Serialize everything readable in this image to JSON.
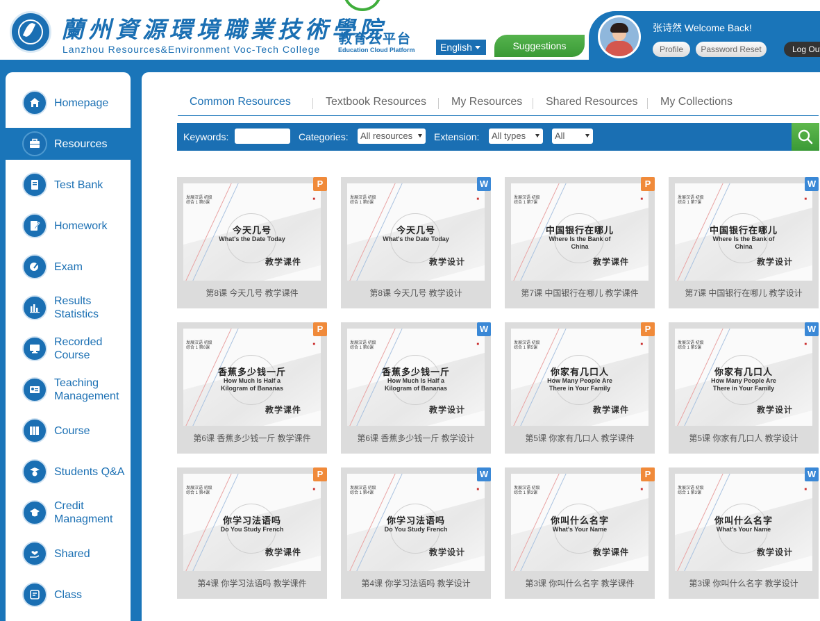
{
  "header": {
    "college_cn": "蘭州資源環境職業技術學院",
    "college_en": "Lanzhou Resources&Environment Voc-Tech College",
    "platform_cn": "教育云平台",
    "platform_en": "Education Cloud Platform",
    "language_label": "English",
    "suggestions_label": "Suggestions",
    "welcome_text": "张诗然 Welcome Back!",
    "profile_label": "Profile",
    "password_reset_label": "Password Reset",
    "logout_label": "Log Out"
  },
  "sidebar": {
    "items": [
      {
        "label": "Homepage",
        "icon": "home-icon"
      },
      {
        "label": "Resources",
        "icon": "briefcase-icon",
        "active": true
      },
      {
        "label": "Test Bank",
        "icon": "notebook-icon"
      },
      {
        "label": "Homework",
        "icon": "pencil-book-icon"
      },
      {
        "label": "Exam",
        "icon": "exam-pen-icon"
      },
      {
        "label": "Results Statistics",
        "icon": "bar-chart-icon"
      },
      {
        "label": "Recorded Course",
        "icon": "monitor-icon"
      },
      {
        "label": "Teaching Management",
        "icon": "id-card-icon"
      },
      {
        "label": "Course",
        "icon": "books-icon"
      },
      {
        "label": "Students Q&A",
        "icon": "student-question-icon"
      },
      {
        "label": "Credit Managment",
        "icon": "graduation-cap-icon"
      },
      {
        "label": "Shared",
        "icon": "hand-heart-icon"
      },
      {
        "label": "Class",
        "icon": "class-book-icon"
      }
    ]
  },
  "tabs": [
    {
      "label": "Common Resources",
      "active": true
    },
    {
      "label": "Textbook Resources"
    },
    {
      "label": "My Resources"
    },
    {
      "label": "Shared Resources"
    },
    {
      "label": "My Collections"
    }
  ],
  "filters": {
    "keywords_label": "Keywords:",
    "keywords_value": "",
    "categories_label": "Categories:",
    "categories_value": "All resources",
    "extension_label": "Extension:",
    "extension_value": "All types",
    "extra_value": "All"
  },
  "colors": {
    "brand_blue": "#1a75b9",
    "accent_green": "#3fae3b",
    "ppt_orange": "#f08a3a",
    "word_blue": "#3a88d6"
  },
  "resources": [
    {
      "badge": "P",
      "note": "发展汉语 初级综合 1 第8课",
      "title_cn": "今天几号",
      "title_en": "What's the Date Today",
      "kind": "教学课件",
      "caption": "第8课 今天几号 教学课件"
    },
    {
      "badge": "W",
      "note": "发展汉语 初级综合 1 第8课",
      "title_cn": "今天几号",
      "title_en": "What's the Date Today",
      "kind": "教学设计",
      "caption": "第8课 今天几号 教学设计"
    },
    {
      "badge": "P",
      "note": "发展汉语 初级综合 1 第7课",
      "title_cn": "中国银行在哪儿",
      "title_en": "Where Is the Bank of China",
      "kind": "教学课件",
      "caption": "第7课 中国银行在哪儿 教学课件"
    },
    {
      "badge": "W",
      "note": "发展汉语 初级综合 1 第7课",
      "title_cn": "中国银行在哪儿",
      "title_en": "Where Is the Bank of China",
      "kind": "教学设计",
      "caption": "第7课 中国银行在哪儿 教学设计"
    },
    {
      "badge": "P",
      "note": "发展汉语 初级综合 1 第6课",
      "title_cn": "香蕉多少钱一斤",
      "title_en": "How Much Is Half a Kilogram of Bananas",
      "kind": "教学课件",
      "caption": "第6课 香蕉多少钱一斤 教学课件"
    },
    {
      "badge": "W",
      "note": "发展汉语 初级综合 1 第6课",
      "title_cn": "香蕉多少钱一斤",
      "title_en": "How Much Is Half a Kilogram of Bananas",
      "kind": "教学设计",
      "caption": "第6课 香蕉多少钱一斤 教学设计"
    },
    {
      "badge": "P",
      "note": "发展汉语 初级综合 1 第5课",
      "title_cn": "你家有几口人",
      "title_en": "How Many People Are There in Your Family",
      "kind": "教学课件",
      "caption": "第5课 你家有几口人 教学课件"
    },
    {
      "badge": "W",
      "note": "发展汉语 初级综合 1 第5课",
      "title_cn": "你家有几口人",
      "title_en": "How Many People Are There in Your Family",
      "kind": "教学设计",
      "caption": "第5课 你家有几口人 教学设计"
    },
    {
      "badge": "P",
      "note": "发展汉语 初级综合 1 第4课",
      "title_cn": "你学习法语吗",
      "title_en": "Do You Study French",
      "kind": "教学课件",
      "caption": "第4课 你学习法语吗 教学课件"
    },
    {
      "badge": "W",
      "note": "发展汉语 初级综合 1 第4课",
      "title_cn": "你学习法语吗",
      "title_en": "Do You Study French",
      "kind": "教学设计",
      "caption": "第4课 你学习法语吗 教学设计"
    },
    {
      "badge": "P",
      "note": "发展汉语 初级综合 1 第3课",
      "title_cn": "你叫什么名字",
      "title_en": "What's Your Name",
      "kind": "教学课件",
      "caption": "第3课 你叫什么名字 教学课件"
    },
    {
      "badge": "W",
      "note": "发展汉语 初级综合 1 第3课",
      "title_cn": "你叫什么名字",
      "title_en": "What's Your Name",
      "kind": "教学设计",
      "caption": "第3课 你叫什么名字 教学设计"
    }
  ]
}
